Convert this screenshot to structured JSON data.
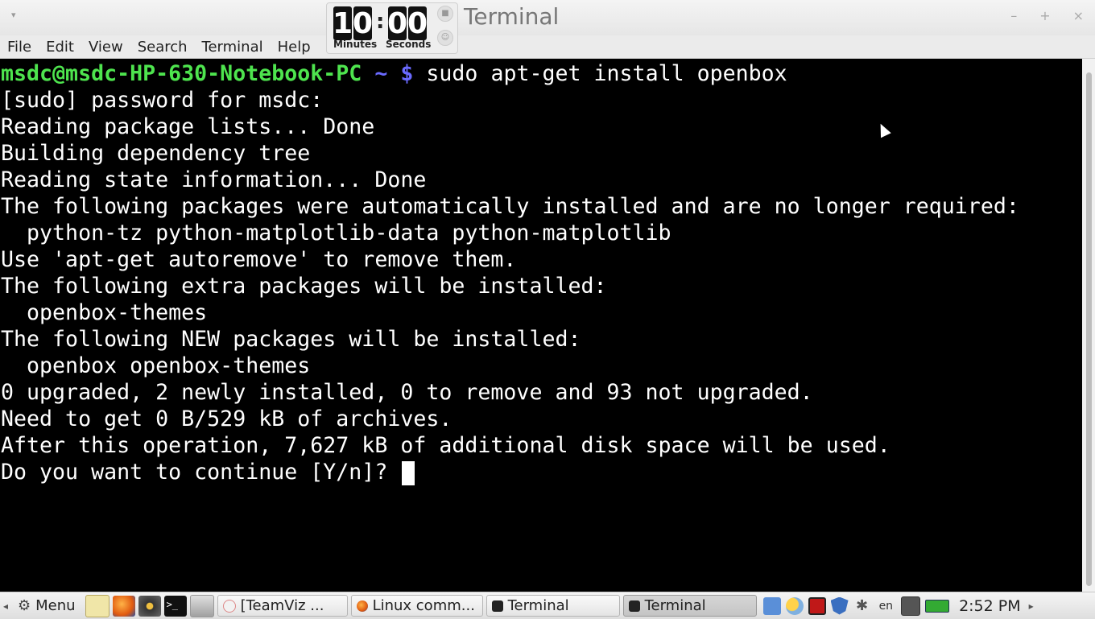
{
  "window": {
    "title": "Terminal",
    "minimize_glyph": "–",
    "maximize_glyph": "+",
    "close_glyph": "×",
    "menu_arrow_glyph": "▾"
  },
  "timer": {
    "minutes_digits": [
      "1",
      "0"
    ],
    "seconds_digits": [
      "0",
      "0"
    ],
    "separator": ":",
    "minutes_label": "Minutes",
    "seconds_label": "Seconds",
    "stop_icon": "stop-icon",
    "face_icon": "face-icon"
  },
  "menubar": {
    "items": [
      "File",
      "Edit",
      "View",
      "Search",
      "Terminal",
      "Help"
    ]
  },
  "terminal": {
    "prompt_user": "msdc@msdc-HP-630-Notebook-PC",
    "prompt_tilde": " ~ ",
    "prompt_dollar": "$",
    "command": " sudo apt-get install openbox",
    "lines": [
      "[sudo] password for msdc:",
      "Reading package lists... Done",
      "Building dependency tree",
      "Reading state information... Done",
      "The following packages were automatically installed and are no longer required:",
      "  python-tz python-matplotlib-data python-matplotlib",
      "Use 'apt-get autoremove' to remove them.",
      "The following extra packages will be installed:",
      "  openbox-themes",
      "The following NEW packages will be installed:",
      "  openbox openbox-themes",
      "0 upgraded, 2 newly installed, 0 to remove and 93 not upgraded.",
      "Need to get 0 B/529 kB of archives.",
      "After this operation, 7,627 kB of additional disk space will be used."
    ],
    "question": "Do you want to continue [Y/n]? "
  },
  "taskbar": {
    "left_arrow": "◂",
    "right_arrow": "▸",
    "menu_label": "Menu",
    "tasks": [
      {
        "label": "[TeamViz ...",
        "icon": "teamviz-icon"
      },
      {
        "label": "Linux comm...",
        "icon": "firefox-icon"
      },
      {
        "label": "Terminal",
        "icon": "terminal-icon"
      },
      {
        "label": "Terminal",
        "icon": "terminal-icon"
      }
    ],
    "language": "en",
    "bluetooth_glyph": "✱",
    "clock": "2:52 PM"
  }
}
